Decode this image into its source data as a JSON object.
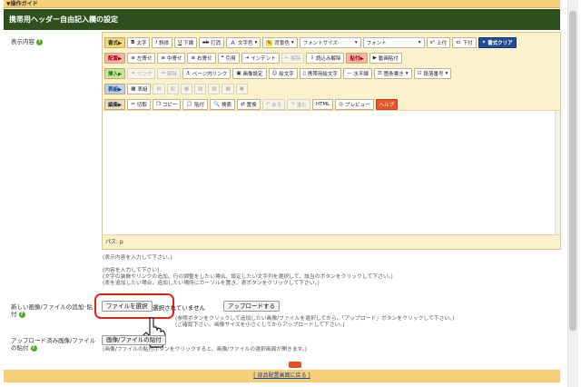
{
  "guide": "▼操作ガイド",
  "title": "携帯用ヘッダー自由記入欄の設定",
  "labels": {
    "content": "表示内容",
    "new_file": "新しい画像/ファイルの追加･貼付",
    "uploaded": "アップロード済み画像/ファイルの貼付"
  },
  "toolbar": {
    "row1": {
      "cat": "書式▶",
      "bold": "太字",
      "italic": "斜体",
      "underline": "下線",
      "strike": "打消",
      "text_color": "文字色",
      "bg_color": "背景色",
      "font_size": "フォントサイズ",
      "font": "フォント",
      "sup": "上付",
      "sub": "下付",
      "clear": "書式クリア"
    },
    "row2": {
      "cat": "配置▶",
      "left": "左寄せ",
      "center": "中寄せ",
      "right": "右寄せ",
      "quote": "引用",
      "indent": "インデント",
      "outdent": "解除",
      "readin": "読込み解除",
      "paste": "貼付▶",
      "video": "動画貼付"
    },
    "row3": {
      "cat": "挿入▶",
      "link": "リンク",
      "unlink": "解除",
      "pagelink": "ページ内リンク",
      "image": "画像設定",
      "emoji": "絵文字",
      "mobile": "携帯用絵文字",
      "hr": "水平線",
      "ul": "箇条書き",
      "ol": "段落番号"
    },
    "row4": {
      "cat": "表組▶",
      "table": "表組"
    },
    "row5": {
      "cat": "編集▶",
      "cut": "切取",
      "copy": "コピー",
      "paste": "貼付",
      "find": "検索",
      "replace": "置換",
      "undo": "戻る",
      "redo": "進む",
      "html": "HTML",
      "preview": "プレビュー",
      "help": "ヘルプ"
    }
  },
  "path": "パス: p",
  "notes": {
    "n1": "(表示内容を入力して下さい。)",
    "n2": "(内容を入力して下さい)",
    "n3": "(文字の装飾やリンクの追加、行の調整をしたい場合、設定したい文字列を選択して、該当のボタンをクリックして下さい。)",
    "n4": "(表を追加したい場合、追加したい場所にカーソルを置き、表ボタンをクリックして下さい。)",
    "n5": "(参照ボタンをクリックして追加したい画像/ファイルを選択してから、「アップロード」ボタンをクリックして下さい。)",
    "n6": "(ご確認下さい、画像サイズを小さくしてからアップロードして下さい。)",
    "n7": "(画像/ファイルの貼付ボタンをクリックすると、画像/ファイルの選択画面が開きます。)"
  },
  "file": {
    "choose": "ファイルを選択",
    "status": "選択されていません",
    "upload": "アップロードする",
    "attach": "画像/ファイルの貼付"
  },
  "footer": "[ 部品配置画面に戻る ]"
}
